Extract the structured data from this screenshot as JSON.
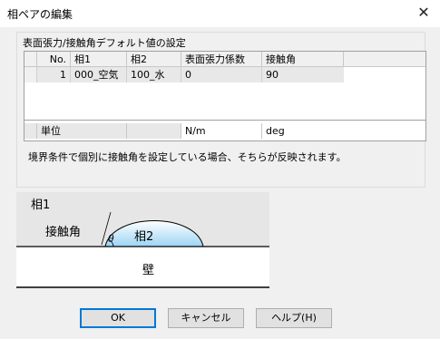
{
  "window": {
    "title": "相ペアの編集",
    "close_glyph": "✕"
  },
  "group": {
    "label": "表面張力/接触角デフォルト値の設定"
  },
  "table": {
    "headers": {
      "no": "No.",
      "phase1": "相1",
      "phase2": "相2",
      "tension": "表面張力係数",
      "angle": "接触角"
    },
    "rows": [
      {
        "no": "1",
        "phase1": "000_空気",
        "phase2": "100_水",
        "tension": "0",
        "angle": "90"
      }
    ],
    "units": {
      "label": "単位",
      "tension": "N/m",
      "angle": "deg"
    }
  },
  "note": "境界条件で個別に接触角を設定している場合、そちらが反映されます。",
  "diagram": {
    "phase1": "相1",
    "phase2": "相2",
    "angle_label": "接触角",
    "theta": "θ",
    "wall": "壁"
  },
  "buttons": {
    "ok": "OK",
    "cancel": "キャンセル",
    "help": "ヘルプ(H)"
  },
  "colors": {
    "drop_fill_top": "#ffffff",
    "drop_fill_bottom": "#9cd4f4",
    "focus_border": "#0078d7"
  }
}
